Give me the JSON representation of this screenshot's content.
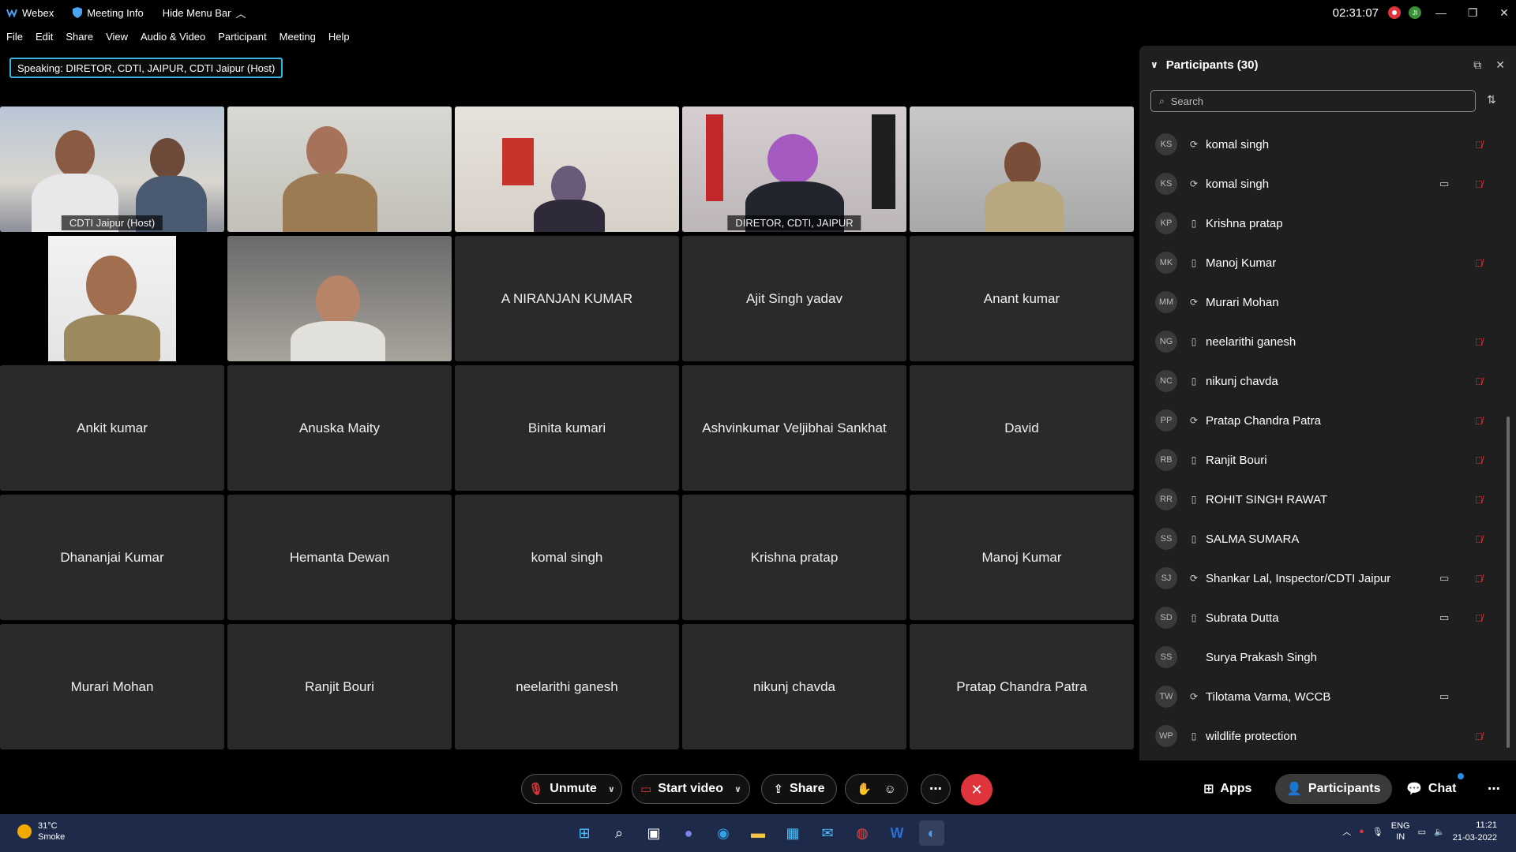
{
  "titlebar": {
    "app": "Webex",
    "meeting_info": "Meeting Info",
    "hide_menu": "Hide Menu Bar",
    "time": "02:31:07"
  },
  "menu": [
    "File",
    "Edit",
    "Share",
    "View",
    "Audio & Video",
    "Participant",
    "Meeting",
    "Help"
  ],
  "speaking": "Speaking: DIRETOR, CDTI, JAIPUR, CDTI Jaipur (Host)",
  "video_tiles": [
    {
      "label": "CDTI Jaipur  (Host)"
    },
    {
      "label": ""
    },
    {
      "label": ""
    },
    {
      "label": "DIRETOR, CDTI, JAIPUR"
    },
    {
      "label": ""
    },
    {
      "label": ""
    },
    {
      "label": ""
    }
  ],
  "name_tiles": [
    "A NIRANJAN KUMAR",
    "Ajit Singh yadav",
    "Anant kumar",
    "Ankit kumar",
    "Anuska Maity",
    "Binita kumari",
    "Ashvinkumar Veljibhai Sankhat",
    "David",
    "Dhananjai Kumar",
    "Hemanta Dewan",
    "komal singh",
    "Krishna pratap",
    "Manoj Kumar",
    "Murari Mohan",
    "Ranjit Bouri",
    "neelarithi ganesh",
    "nikunj chavda",
    "Pratap Chandra Patra"
  ],
  "panel": {
    "title": "Participants (30)",
    "search_placeholder": "Search"
  },
  "participants": [
    {
      "initials": "KS",
      "name": "komal singh",
      "device": "sync-icon",
      "cam": false,
      "mic": true
    },
    {
      "initials": "KS",
      "name": "komal singh",
      "device": "sync-icon",
      "cam": true,
      "mic": true
    },
    {
      "initials": "KP",
      "name": "Krishna pratap",
      "device": "phone-icon",
      "cam": false,
      "mic": false
    },
    {
      "initials": "MK",
      "name": "Manoj Kumar",
      "device": "phone-icon",
      "cam": false,
      "mic": true
    },
    {
      "initials": "MM",
      "name": "Murari Mohan",
      "device": "sync-icon",
      "cam": false,
      "mic": false
    },
    {
      "initials": "NG",
      "name": "neelarithi ganesh",
      "device": "phone-icon",
      "cam": false,
      "mic": true
    },
    {
      "initials": "NC",
      "name": "nikunj chavda",
      "device": "phone-icon",
      "cam": false,
      "mic": true
    },
    {
      "initials": "PP",
      "name": "Pratap Chandra Patra",
      "device": "sync-icon",
      "cam": false,
      "mic": true
    },
    {
      "initials": "RB",
      "name": "Ranjit Bouri",
      "device": "phone-icon",
      "cam": false,
      "mic": true
    },
    {
      "initials": "RR",
      "name": "ROHIT SINGH RAWAT",
      "device": "phone-icon",
      "cam": false,
      "mic": true
    },
    {
      "initials": "SS",
      "name": "SALMA SUMARA",
      "device": "phone-icon",
      "cam": false,
      "mic": true
    },
    {
      "initials": "SJ",
      "name": "Shankar Lal, Inspector/CDTI Jaipur",
      "device": "sync-icon",
      "cam": true,
      "mic": true
    },
    {
      "initials": "SD",
      "name": "Subrata Dutta",
      "device": "phone-icon",
      "cam": true,
      "mic": true
    },
    {
      "initials": "SS",
      "name": "Surya Prakash Singh",
      "device": "",
      "cam": false,
      "mic": false
    },
    {
      "initials": "TW",
      "name": "Tilotama Varma, WCCB",
      "device": "sync-icon",
      "cam": true,
      "mic": false
    },
    {
      "initials": "WP",
      "name": "wildlife protection",
      "device": "phone-icon",
      "cam": false,
      "mic": true
    }
  ],
  "controls": {
    "unmute": "Unmute",
    "start_video": "Start video",
    "share": "Share",
    "apps": "Apps",
    "participants": "Participants",
    "chat": "Chat"
  },
  "taskbar": {
    "temp": "31°C",
    "weather": "Smoke",
    "lang1": "ENG",
    "lang2": "IN",
    "time": "11:21",
    "date": "21-03-2022"
  },
  "colors": {
    "accent": "#35b6e0",
    "danger": "#e0343c",
    "tile": "#2a2a2a",
    "panel": "#1f1f1f"
  }
}
